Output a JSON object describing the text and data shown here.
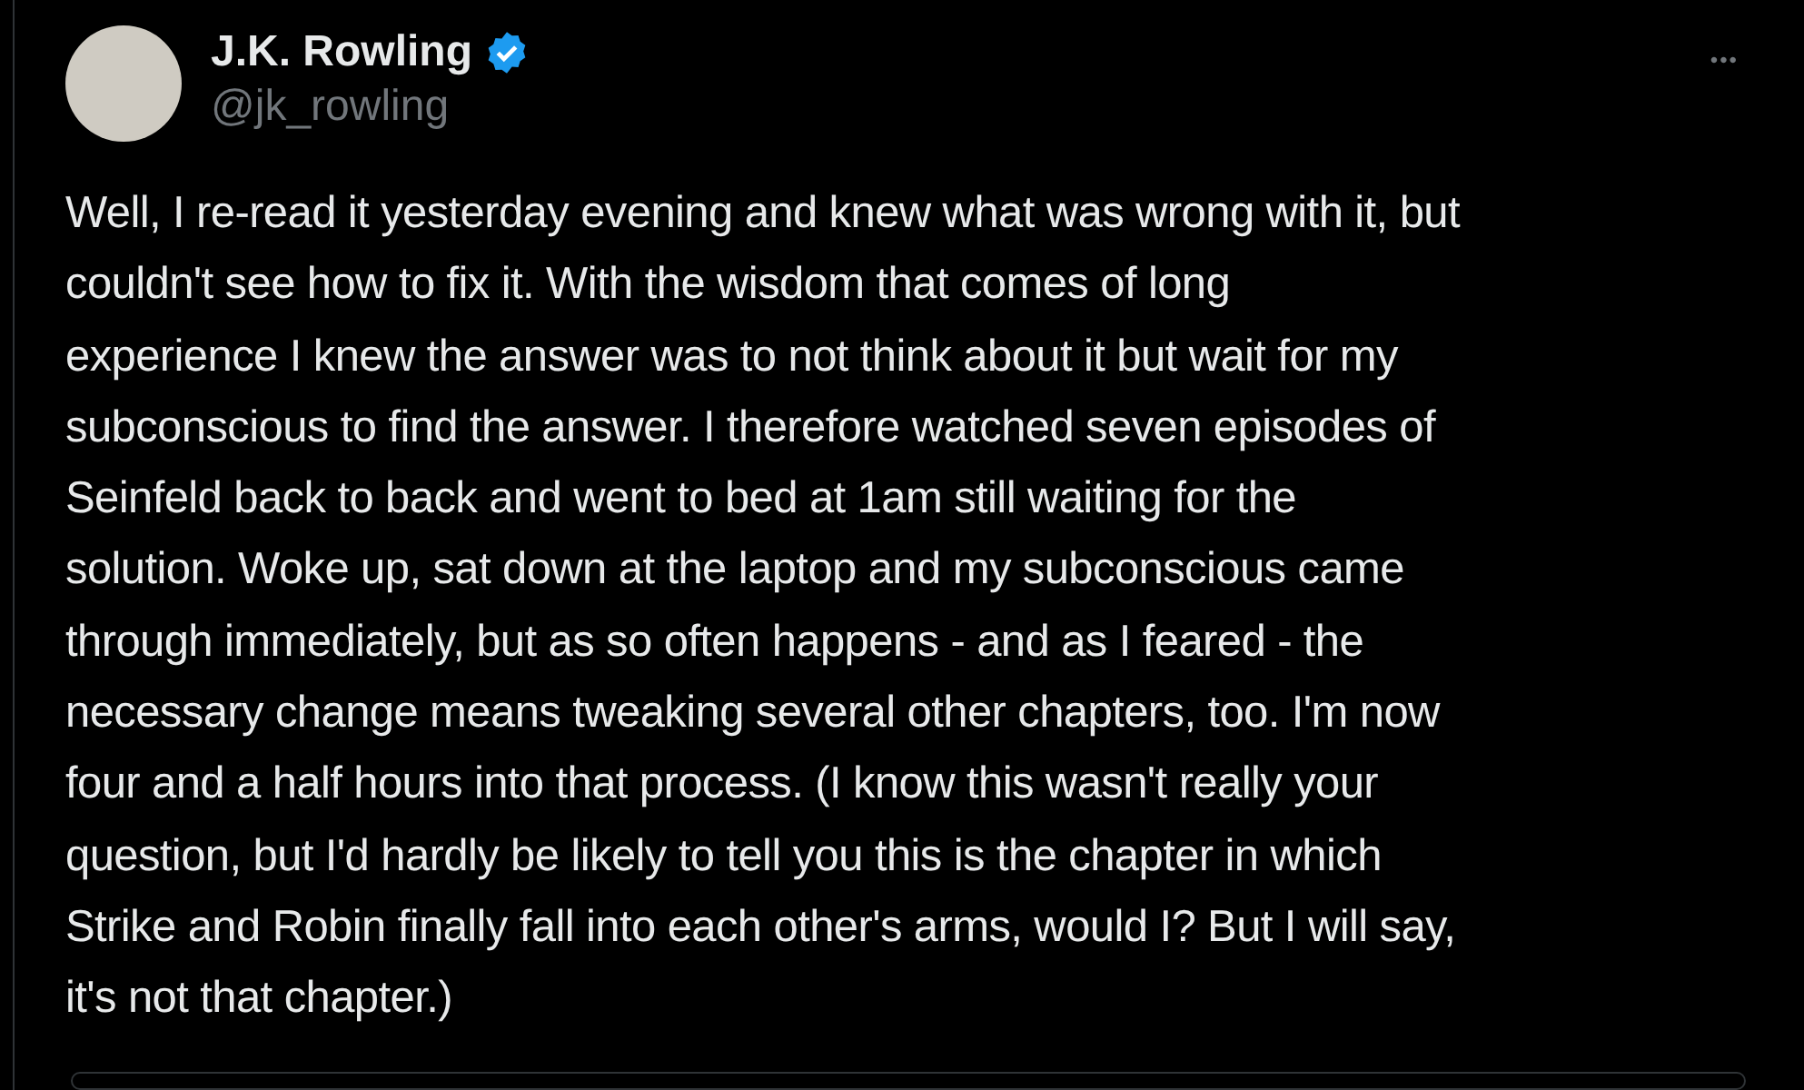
{
  "author": {
    "name": "J.K. Rowling",
    "verified": true,
    "handle": "@jk_rowling"
  },
  "more_button": "•••",
  "text": "Well, I re-read it yesterday evening and knew what was wrong with it, but\ncouldn't see how to fix it. With the wisdom that comes of long\nexperience I knew the answer was to not think about it but wait for my\nsubconscious to find the answer. I therefore watched seven episodes of\nSeinfeld back to back and went to bed at 1am still waiting for the\nsolution. Woke up, sat down at the laptop and my subconscious came\nthrough immediately, but as so often happens - and as I feared - the\nnecessary change means tweaking several other chapters, too. I'm now\nfour and a half hours into that process. (I know this wasn't really your\nquestion, but I'd hardly be likely to tell you this is the chapter in which\nStrike and Robin finally fall into each other's arms, would I? But I will say,\nit's not that chapter.)"
}
